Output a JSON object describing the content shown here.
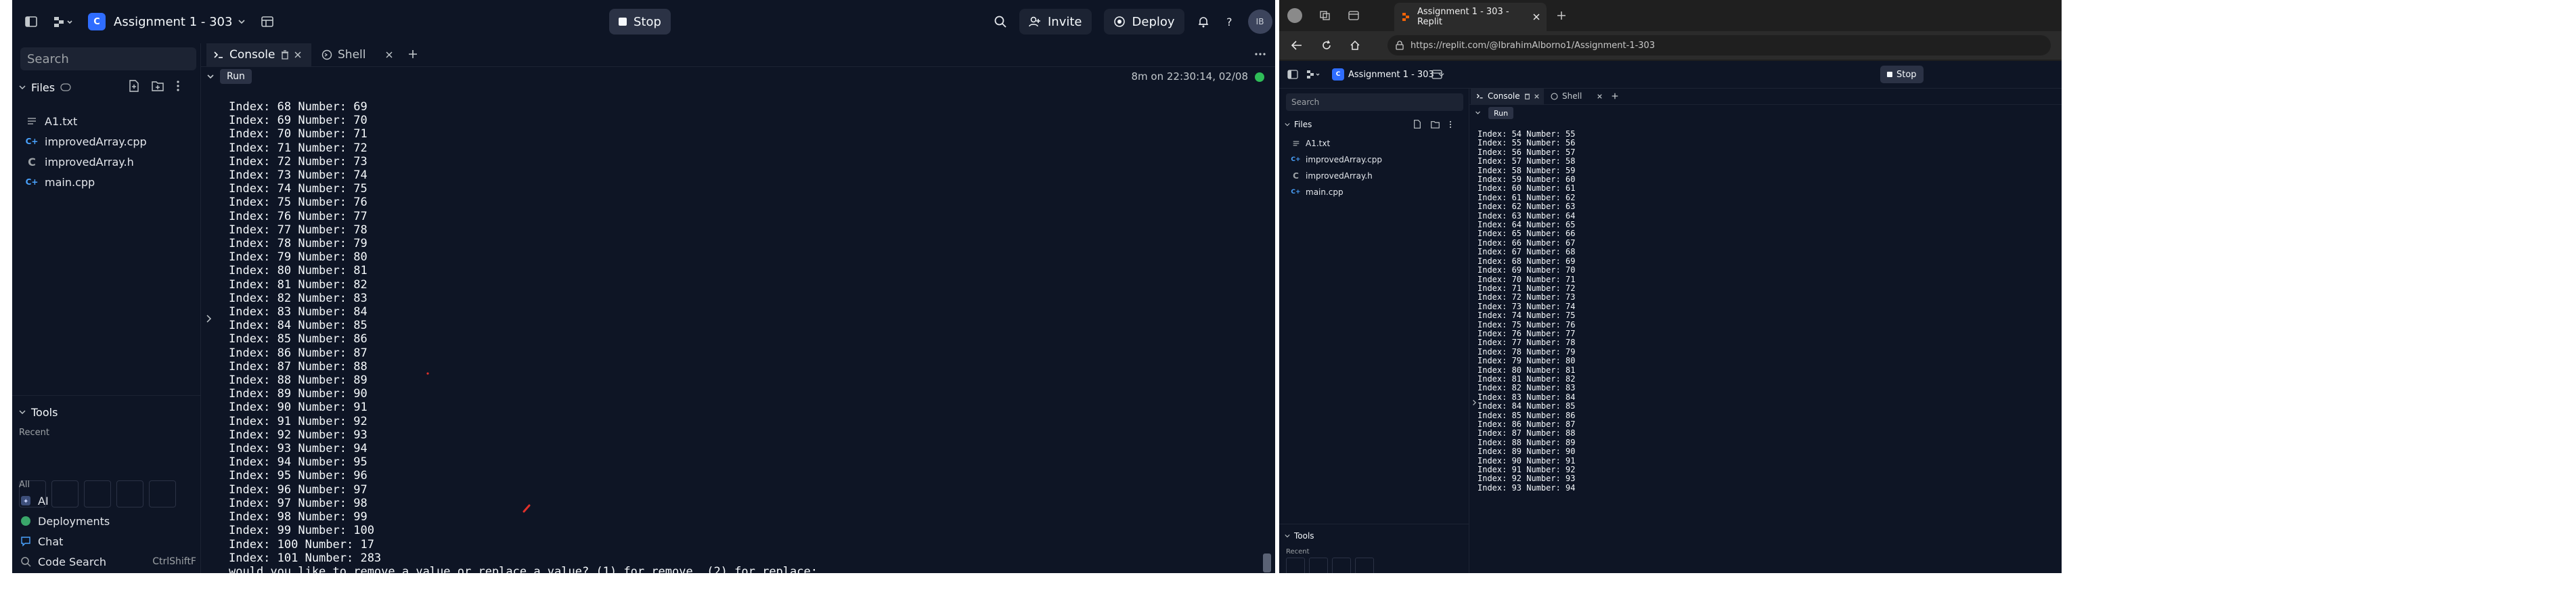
{
  "app": {
    "title": "Assignment 1 - 303",
    "stop_label": "Stop",
    "invite_label": "Invite",
    "deploy_label": "Deploy",
    "avatar_initials": "IB"
  },
  "sidebar": {
    "search_placeholder": "Search",
    "files_label": "Files",
    "files": [
      {
        "name": "A1.txt",
        "icon": "text-file-icon"
      },
      {
        "name": "improvedArray.cpp",
        "icon": "cpp-file-icon"
      },
      {
        "name": "improvedArray.h",
        "icon": "header-file-icon"
      },
      {
        "name": "main.cpp",
        "icon": "cpp-file-icon"
      }
    ],
    "tools_label": "Tools",
    "recent_label": "Recent",
    "all_label": "All",
    "tools": [
      {
        "name": "AI",
        "icon": "ai-icon"
      },
      {
        "name": "Deployments",
        "icon": "deployments-icon"
      },
      {
        "name": "Chat",
        "icon": "chat-icon"
      },
      {
        "name": "Code Search",
        "icon": "search-icon",
        "shortcut": "CtrlShiftF"
      }
    ]
  },
  "panel": {
    "tabs": [
      {
        "label": "Console",
        "icon": "console-icon",
        "active": true
      },
      {
        "label": "Shell",
        "icon": "shell-icon",
        "active": false
      }
    ],
    "run_label": "Run",
    "status_text": "8m on 22:30:14, 02/08"
  },
  "console_left": [
    "Index: 68 Number: 69",
    "Index: 69 Number: 70",
    "Index: 70 Number: 71",
    "Index: 71 Number: 72",
    "Index: 72 Number: 73",
    "Index: 73 Number: 74",
    "Index: 74 Number: 75",
    "Index: 75 Number: 76",
    "Index: 76 Number: 77",
    "Index: 77 Number: 78",
    "Index: 78 Number: 79",
    "Index: 79 Number: 80",
    "Index: 80 Number: 81",
    "Index: 81 Number: 82",
    "Index: 82 Number: 83",
    "Index: 83 Number: 84",
    "Index: 84 Number: 85",
    "Index: 85 Number: 86",
    "Index: 86 Number: 87",
    "Index: 87 Number: 88",
    "Index: 88 Number: 89",
    "Index: 89 Number: 90",
    "Index: 90 Number: 91",
    "Index: 91 Number: 92",
    "Index: 92 Number: 93",
    "Index: 93 Number: 94",
    "Index: 94 Number: 95",
    "Index: 95 Number: 96",
    "Index: 96 Number: 97",
    "Index: 97 Number: 98",
    "Index: 98 Number: 99",
    "Index: 99 Number: 100",
    "Index: 100 Number: 17",
    "Index: 101 Number: 283",
    "would you like to remove a value or replace a value? (1) for remove, (2) for replace:"
  ],
  "browser": {
    "tab_title": "Assignment 1 - 303 - Replit",
    "url": "https://replit.com/@IbrahimAlborno1/Assignment-1-303"
  },
  "console_right": [
    "Index: 54 Number: 55",
    "Index: 55 Number: 56",
    "Index: 56 Number: 57",
    "Index: 57 Number: 58",
    "Index: 58 Number: 59",
    "Index: 59 Number: 60",
    "Index: 60 Number: 61",
    "Index: 61 Number: 62",
    "Index: 62 Number: 63",
    "Index: 63 Number: 64",
    "Index: 64 Number: 65",
    "Index: 65 Number: 66",
    "Index: 66 Number: 67",
    "Index: 67 Number: 68",
    "Index: 68 Number: 69",
    "Index: 69 Number: 70",
    "Index: 70 Number: 71",
    "Index: 71 Number: 72",
    "Index: 72 Number: 73",
    "Index: 73 Number: 74",
    "Index: 74 Number: 75",
    "Index: 75 Number: 76",
    "Index: 76 Number: 77",
    "Index: 77 Number: 78",
    "Index: 78 Number: 79",
    "Index: 79 Number: 80",
    "Index: 80 Number: 81",
    "Index: 81 Number: 82",
    "Index: 82 Number: 83",
    "Index: 83 Number: 84",
    "Index: 84 Number: 85",
    "Index: 85 Number: 86",
    "Index: 86 Number: 87",
    "Index: 87 Number: 88",
    "Index: 88 Number: 89",
    "Index: 89 Number: 90",
    "Index: 90 Number: 91",
    "Index: 91 Number: 92",
    "Index: 92 Number: 93",
    "Index: 93 Number: 94"
  ],
  "colors": {
    "background": "#0e1525",
    "accent": "#2f6dff",
    "status_green": "#2fbd58"
  }
}
